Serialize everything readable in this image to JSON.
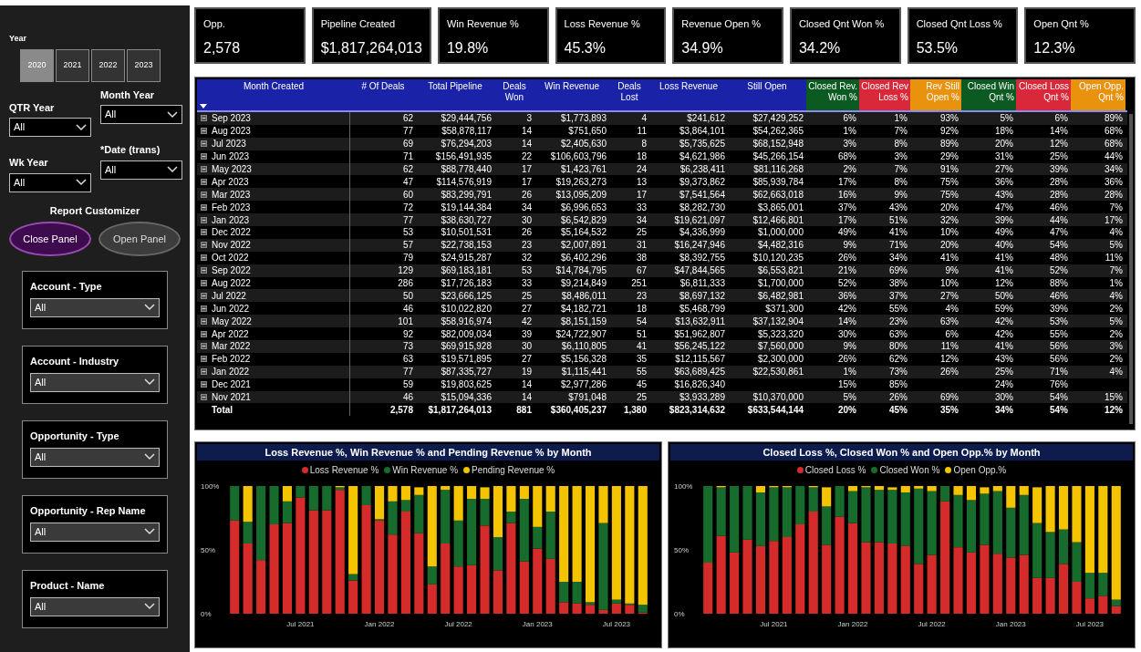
{
  "filters": {
    "year": {
      "label": "Year",
      "options": [
        {
          "label": "2020",
          "selected": true
        },
        {
          "label": "2021",
          "selected": false
        },
        {
          "label": "2022",
          "selected": false
        },
        {
          "label": "2023",
          "selected": false
        }
      ]
    },
    "dropdowns": [
      {
        "label": "QTR Year",
        "value": "All"
      },
      {
        "label": "Month Year",
        "value": "All"
      },
      {
        "label": "Wk Year",
        "value": "All"
      },
      {
        "label": "*Date (trans)",
        "value": "All"
      }
    ],
    "customizer": {
      "title": "Report Customizer",
      "buttons": [
        {
          "label": "Close Panel",
          "selected": true
        },
        {
          "label": "Open Panel",
          "selected": false
        }
      ]
    },
    "slicers": [
      {
        "label": "Account - Type",
        "value": "All"
      },
      {
        "label": "Account - Industry",
        "value": "All"
      },
      {
        "label": "Opportunity - Type",
        "value": "All"
      },
      {
        "label": "Opportunity - Rep Name",
        "value": "All"
      },
      {
        "label": "Product - Name",
        "value": "All"
      }
    ]
  },
  "kpis": [
    {
      "label": "Opp.",
      "value": "2,578"
    },
    {
      "label": "Pipeline Created",
      "value": "$1,817,264,013"
    },
    {
      "label": "Win Revenue %",
      "value": "19.8%"
    },
    {
      "label": "Loss Revenue %",
      "value": "45.3%"
    },
    {
      "label": "Revenue Open %",
      "value": "34.9%"
    },
    {
      "label": "Closed Qnt Won %",
      "value": "34.2%"
    },
    {
      "label": "Closed Qnt Loss %",
      "value": "53.5%"
    },
    {
      "label": "Open Qnt %",
      "value": "12.3%"
    }
  ],
  "table": {
    "columns": [
      {
        "label": "Month Created",
        "color": "#1a22a8"
      },
      {
        "label": "# Of Deals",
        "color": "#1a22a8"
      },
      {
        "label": "Total Pipeline",
        "color": "#1a22a8"
      },
      {
        "label": "Deals Won",
        "color": "#1a22a8"
      },
      {
        "label": "Win Revenue",
        "color": "#1a22a8"
      },
      {
        "label": "Deals Lost",
        "color": "#1a22a8"
      },
      {
        "label": "Loss Revenue",
        "color": "#1a22a8"
      },
      {
        "label": "Still Open",
        "color": "#1a22a8"
      },
      {
        "label": "Closed Rev. Won %",
        "color": "#0b5a22"
      },
      {
        "label": "Closed Rev Loss %",
        "color": "#d8283a"
      },
      {
        "label": "Rev Still Open %",
        "color": "#e8920e"
      },
      {
        "label": "Closed Win Qnt %",
        "color": "#0b5a22"
      },
      {
        "label": "Closed Loss Qnt %",
        "color": "#d8283a"
      },
      {
        "label": "Open Opp. Qnt %",
        "color": "#e8920e"
      }
    ],
    "rows": [
      [
        "Sep 2023",
        "62",
        "$29,444,756",
        "3",
        "$1,773,893",
        "4",
        "$241,612",
        "$27,429,252",
        "6%",
        "1%",
        "93%",
        "5%",
        "6%",
        "89%"
      ],
      [
        "Aug 2023",
        "77",
        "$58,878,117",
        "14",
        "$751,650",
        "11",
        "$3,864,101",
        "$54,262,365",
        "1%",
        "7%",
        "92%",
        "18%",
        "14%",
        "68%"
      ],
      [
        "Jul 2023",
        "69",
        "$76,294,203",
        "14",
        "$2,405,630",
        "8",
        "$5,735,625",
        "$68,152,948",
        "3%",
        "8%",
        "89%",
        "20%",
        "12%",
        "68%"
      ],
      [
        "Jun 2023",
        "71",
        "$156,491,935",
        "22",
        "$106,603,796",
        "18",
        "$4,621,986",
        "$45,266,154",
        "68%",
        "3%",
        "29%",
        "31%",
        "25%",
        "44%"
      ],
      [
        "May 2023",
        "62",
        "$88,778,440",
        "17",
        "$1,423,761",
        "24",
        "$6,238,411",
        "$81,116,268",
        "2%",
        "7%",
        "91%",
        "27%",
        "39%",
        "34%"
      ],
      [
        "Apr 2023",
        "47",
        "$114,576,919",
        "17",
        "$19,263,273",
        "13",
        "$9,373,862",
        "$85,939,784",
        "17%",
        "8%",
        "75%",
        "36%",
        "28%",
        "36%"
      ],
      [
        "Mar 2023",
        "60",
        "$83,299,791",
        "26",
        "$13,095,209",
        "17",
        "$7,541,564",
        "$62,663,018",
        "16%",
        "9%",
        "75%",
        "43%",
        "28%",
        "28%"
      ],
      [
        "Feb 2023",
        "72",
        "$19,144,384",
        "34",
        "$6,996,653",
        "33",
        "$8,282,730",
        "$3,865,001",
        "37%",
        "43%",
        "20%",
        "47%",
        "46%",
        "7%"
      ],
      [
        "Jan 2023",
        "77",
        "$38,630,727",
        "30",
        "$6,542,829",
        "34",
        "$19,621,097",
        "$12,466,801",
        "17%",
        "51%",
        "32%",
        "39%",
        "44%",
        "17%"
      ],
      [
        "Dec 2022",
        "53",
        "$10,501,531",
        "26",
        "$5,164,532",
        "25",
        "$4,336,999",
        "$1,000,000",
        "49%",
        "41%",
        "10%",
        "49%",
        "47%",
        "4%"
      ],
      [
        "Nov 2022",
        "57",
        "$22,738,153",
        "23",
        "$2,007,891",
        "31",
        "$16,247,946",
        "$4,482,316",
        "9%",
        "71%",
        "20%",
        "40%",
        "54%",
        "5%"
      ],
      [
        "Oct 2022",
        "79",
        "$24,915,287",
        "32",
        "$6,402,296",
        "38",
        "$8,392,755",
        "$10,120,235",
        "26%",
        "34%",
        "41%",
        "41%",
        "48%",
        "11%"
      ],
      [
        "Sep 2022",
        "129",
        "$69,183,181",
        "53",
        "$14,784,795",
        "67",
        "$47,844,565",
        "$6,553,821",
        "21%",
        "69%",
        "9%",
        "41%",
        "52%",
        "7%"
      ],
      [
        "Aug 2022",
        "286",
        "$17,726,183",
        "33",
        "$9,214,849",
        "251",
        "$6,811,333",
        "$1,700,000",
        "52%",
        "38%",
        "10%",
        "12%",
        "88%",
        "1%"
      ],
      [
        "Jul 2022",
        "50",
        "$23,666,125",
        "25",
        "$8,486,011",
        "23",
        "$8,697,132",
        "$6,482,981",
        "36%",
        "37%",
        "27%",
        "50%",
        "46%",
        "4%"
      ],
      [
        "Jun 2022",
        "46",
        "$10,022,820",
        "27",
        "$4,182,721",
        "18",
        "$5,468,799",
        "$371,300",
        "42%",
        "55%",
        "4%",
        "59%",
        "39%",
        "2%"
      ],
      [
        "May 2022",
        "101",
        "$58,916,974",
        "42",
        "$8,151,159",
        "54",
        "$13,632,911",
        "$37,132,904",
        "14%",
        "23%",
        "63%",
        "42%",
        "53%",
        "5%"
      ],
      [
        "Apr 2022",
        "92",
        "$82,009,034",
        "39",
        "$24,722,907",
        "51",
        "$51,962,807",
        "$5,323,320",
        "30%",
        "63%",
        "6%",
        "42%",
        "55%",
        "2%"
      ],
      [
        "Mar 2022",
        "73",
        "$69,915,928",
        "30",
        "$6,110,805",
        "41",
        "$56,245,122",
        "$7,560,000",
        "9%",
        "80%",
        "11%",
        "41%",
        "56%",
        "3%"
      ],
      [
        "Feb 2022",
        "63",
        "$19,571,895",
        "27",
        "$5,156,328",
        "35",
        "$12,115,567",
        "$2,300,000",
        "26%",
        "62%",
        "12%",
        "43%",
        "56%",
        "2%"
      ],
      [
        "Jan 2022",
        "77",
        "$87,335,727",
        "19",
        "$1,115,441",
        "55",
        "$63,689,425",
        "$22,530,861",
        "1%",
        "73%",
        "26%",
        "25%",
        "71%",
        "4%"
      ],
      [
        "Dec 2021",
        "59",
        "$19,803,625",
        "14",
        "$2,977,286",
        "45",
        "$16,826,340",
        null,
        "15%",
        "85%",
        null,
        "24%",
        "76%",
        null
      ],
      [
        "Nov 2021",
        "46",
        "$15,094,336",
        "14",
        "$791,048",
        "25",
        "$3,933,289",
        "$10,370,000",
        "5%",
        "26%",
        "69%",
        "30%",
        "54%",
        "15%"
      ]
    ],
    "total": [
      "Total",
      "2,578",
      "$1,817,264,013",
      "881",
      "$360,405,237",
      "1,380",
      "$823,314,632",
      "$633,544,144",
      "20%",
      "45%",
      "35%",
      "34%",
      "54%",
      "12%"
    ]
  },
  "charts": [
    {
      "chart_data": {
        "type": "bar",
        "stacked": true,
        "title": "Loss Revenue %, Win Revenue % and Pending Revenue % by Month",
        "categories": [
          null,
          null,
          null,
          null,
          null,
          "Jul 2021",
          null,
          null,
          null,
          null,
          null,
          "Jan 2022",
          null,
          null,
          null,
          null,
          null,
          "Jul 2022",
          null,
          null,
          null,
          null,
          null,
          "Jan 2023",
          null,
          null,
          null,
          null,
          null,
          "Jul 2023",
          null,
          null
        ],
        "series": [
          {
            "name": "Loss Revenue %",
            "color": "#d62b2b",
            "values": [
              73,
              55,
              42,
              70,
              71,
              91,
              81,
              81,
              97,
              26,
              85,
              73,
              62,
              80,
              63,
              23,
              55,
              37,
              38,
              69,
              34,
              71,
              41,
              51,
              43,
              9,
              8,
              7,
              3,
              8,
              7,
              1
            ]
          },
          {
            "name": "Win Revenue %",
            "color": "#176b2c",
            "values": [
              27,
              17,
              58,
              30,
              17,
              9,
              19,
              19,
              2,
              5,
              15,
              1,
              26,
              9,
              30,
              14,
              42,
              36,
              52,
              21,
              26,
              9,
              49,
              17,
              37,
              16,
              17,
              2,
              68,
              3,
              1,
              6
            ]
          },
          {
            "name": "Pending Revenue %",
            "color": "#f5c400",
            "values": [
              0,
              28,
              0,
              0,
              12,
              0,
              0,
              0,
              1,
              69,
              null,
              26,
              12,
              11,
              6,
              63,
              3,
              27,
              10,
              9,
              40,
              20,
              10,
              32,
              20,
              75,
              75,
              91,
              29,
              89,
              92,
              93
            ]
          }
        ],
        "ylim": [
          0,
          100
        ],
        "yticks": [
          {
            "value": 0,
            "label": "0%"
          },
          {
            "value": 50,
            "label": "50%"
          },
          {
            "value": 100,
            "label": "100%"
          }
        ]
      }
    },
    {
      "chart_data": {
        "type": "bar",
        "stacked": true,
        "title": "Closed Loss %, Closed Won % and Open Opp.% by Month",
        "categories": [
          null,
          null,
          null,
          null,
          null,
          "Jul 2021",
          null,
          null,
          null,
          null,
          null,
          "Jan 2022",
          null,
          null,
          null,
          null,
          null,
          "Jul 2022",
          null,
          null,
          null,
          null,
          null,
          "Jan 2023",
          null,
          null,
          null,
          null,
          null,
          "Jul 2023",
          null,
          null
        ],
        "series": [
          {
            "name": "Closed Loss %",
            "color": "#d62b2b",
            "values": [
              40,
              61,
              48,
              58,
              53,
              57,
              60,
              70,
              80,
              54,
              76,
              71,
              56,
              56,
              55,
              53,
              39,
              46,
              88,
              52,
              48,
              54,
              47,
              44,
              46,
              28,
              28,
              39,
              25,
              12,
              14,
              6
            ]
          },
          {
            "name": "Closed Won %",
            "color": "#176b2c",
            "values": [
              60,
              38,
              52,
              42,
              42,
              42,
              39,
              30,
              19,
              30,
              24,
              25,
              43,
              41,
              42,
              42,
              59,
              50,
              12,
              41,
              41,
              40,
              49,
              39,
              47,
              43,
              36,
              27,
              31,
              20,
              18,
              5
            ]
          },
          {
            "name": "Open Opp.%",
            "color": "#f5c400",
            "values": [
              0,
              1,
              0,
              0,
              5,
              1,
              1,
              0,
              1,
              15,
              null,
              4,
              1,
              3,
              2,
              5,
              2,
              4,
              0,
              7,
              11,
              5,
              4,
              17,
              7,
              28,
              36,
              34,
              44,
              68,
              68,
              89
            ]
          }
        ],
        "ylim": [
          0,
          100
        ],
        "yticks": [
          {
            "value": 0,
            "label": "0%"
          },
          {
            "value": 50,
            "label": "50%"
          },
          {
            "value": 100,
            "label": "100%"
          }
        ]
      }
    }
  ]
}
